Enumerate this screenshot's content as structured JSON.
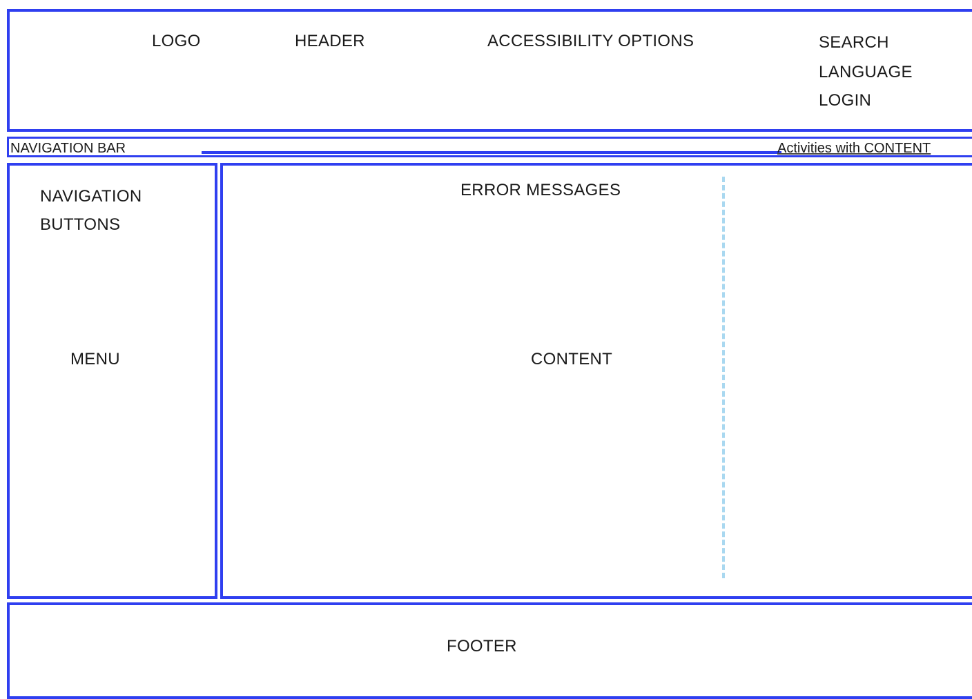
{
  "header": {
    "logo": "LOGO",
    "title": "HEADER",
    "accessibility": "ACCESSIBILITY OPTIONS",
    "search": "SEARCH",
    "language": "LANGUAGE",
    "login": "LOGIN"
  },
  "navbar": {
    "label": "NAVIGATION BAR",
    "activities": "Activities with CONTENT"
  },
  "sidebar": {
    "nav_buttons": "NAVIGATION\nBUTTONS",
    "menu": "MENU"
  },
  "main": {
    "error_messages": "ERROR MESSAGES",
    "content": "CONTENT"
  },
  "footer": {
    "label": "FOOTER"
  },
  "colors": {
    "border": "#2f3ff0",
    "divider": "#a9d8f0"
  }
}
